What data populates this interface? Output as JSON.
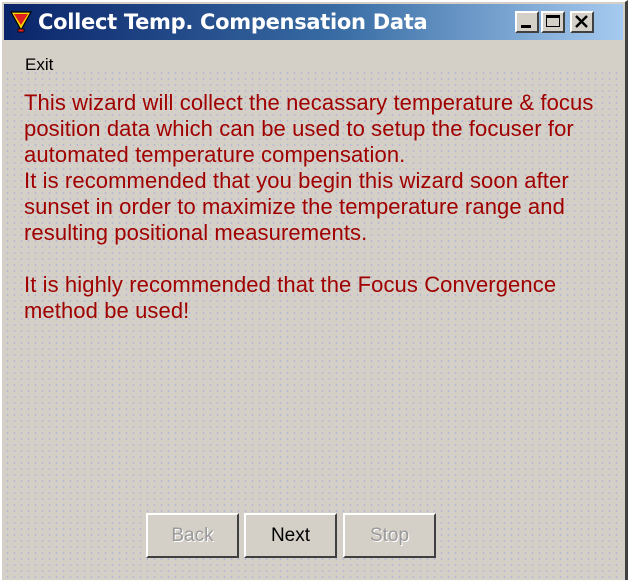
{
  "window": {
    "title": "Collect Temp. Compensation Data"
  },
  "menu": {
    "exit_label": "Exit"
  },
  "message": {
    "paragraph1": "This wizard will collect the necassary temperature & focus position data which can be used to setup the focuser for automated temperature compensation.",
    "paragraph2": "It is recommended that you begin this wizard soon after sunset in order to maximize the temperature range and resulting positional measurements.",
    "paragraph3": "It is highly recommended that the Focus Convergence method be used!"
  },
  "buttons": {
    "back_label": "Back",
    "next_label": "Next",
    "stop_label": "Stop"
  },
  "colors": {
    "message_text": "#a00000",
    "title_bar_start": "#0a246a",
    "title_bar_end": "#a6caf0",
    "window_face": "#d4d0c8"
  },
  "icons": {
    "app": "funnel-icon",
    "minimize": "minimize-icon",
    "maximize": "maximize-icon",
    "close": "close-icon"
  }
}
